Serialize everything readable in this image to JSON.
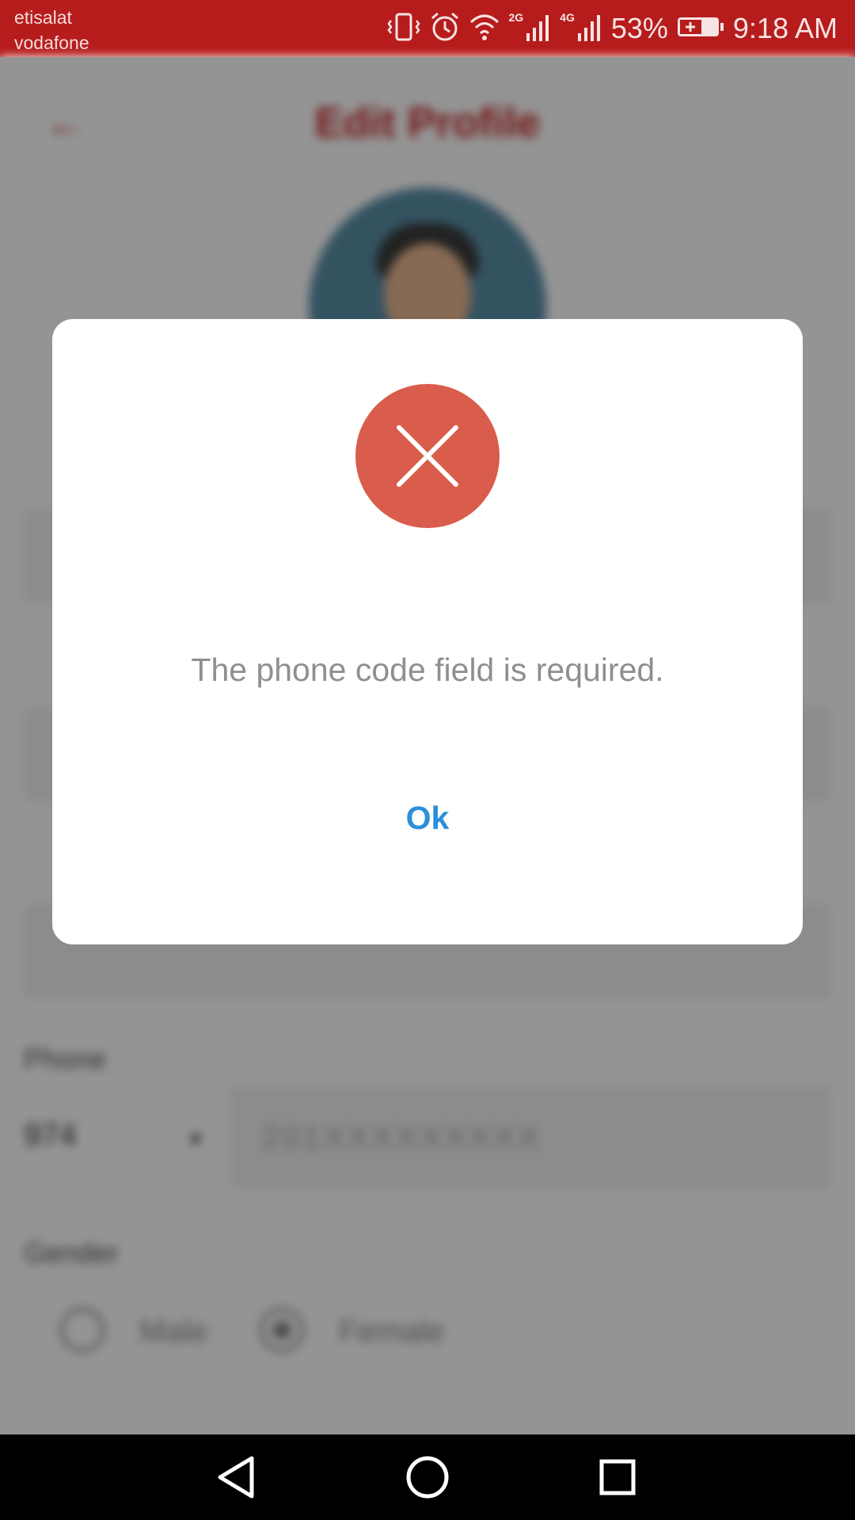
{
  "status_bar": {
    "carrier_1": "etisalat",
    "carrier_2": "vodafone",
    "net_1": "2G",
    "net_2": "4G",
    "battery": "53%",
    "time": "9:18 AM",
    "bg_color": "#b71c1c",
    "icons": [
      "vibrate-icon",
      "alarm-icon",
      "wifi-icon",
      "signal-icon",
      "signal-icon",
      "battery-charging-icon"
    ]
  },
  "background_page": {
    "title": "Edit Profile",
    "phone_label": "Phone",
    "phone_code": "974",
    "phone_placeholder": "201XXXXXXXXX",
    "gender_label": "Gender",
    "gender_male": "Male",
    "gender_female": "Female",
    "accent_color": "#c62828"
  },
  "dialog": {
    "icon": "error-x-icon",
    "icon_color": "#d95c4c",
    "message": "The phone code field is required.",
    "ok_label": "Ok",
    "ok_color": "#2b8fd9"
  },
  "nav_bar": {
    "icons": [
      "back-triangle-icon",
      "home-circle-icon",
      "recents-square-icon"
    ]
  }
}
